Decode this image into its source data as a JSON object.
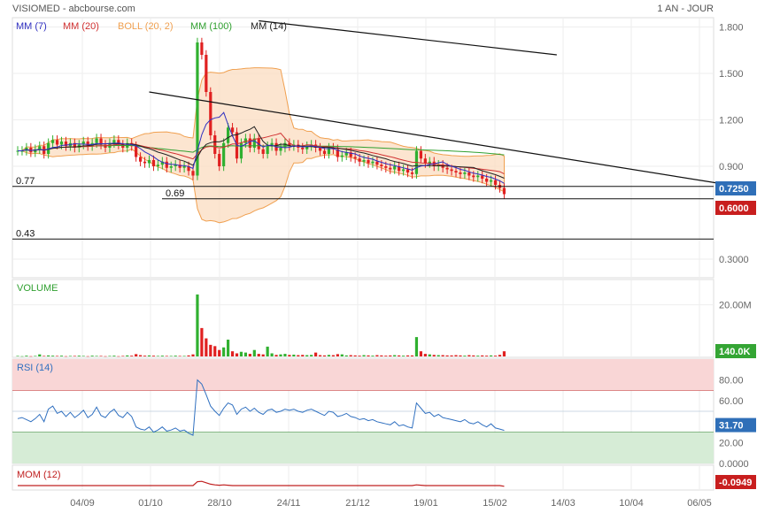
{
  "header": {
    "title": "VISIOMED - abcbourse.com",
    "period": "1 AN - JOUR"
  },
  "colors": {
    "mm7": "#3030c0",
    "mm20": "#d03030",
    "boll": "#f0a050",
    "boll_fill": "#fbdcc0",
    "mm100": "#30a030",
    "mm14": "#222222",
    "up": "#30b030",
    "down": "#e02020",
    "rsi_line": "#3070c0",
    "rsi_high_zone": "#f9d6d6",
    "rsi_low_zone": "#d6ecd6",
    "mom": "#c02020",
    "tag_blue": "#2f6fb8",
    "tag_red": "#c81e1e",
    "tag_green": "#34a534"
  },
  "chart_data": [
    {
      "type": "candlestick",
      "panel": "price",
      "legend": [
        {
          "label": "MM (7)",
          "color": "#3030c0"
        },
        {
          "label": "MM (20)",
          "color": "#d03030"
        },
        {
          "label": "BOLL (20, 2)",
          "color": "#f0a050"
        },
        {
          "label": "MM (100)",
          "color": "#30a030"
        },
        {
          "label": "MM (14)",
          "color": "#222222"
        }
      ],
      "y_ticks": [
        "1.800",
        "1.500",
        "1.200",
        "0.900",
        "0.3000"
      ],
      "y_tick_values": [
        1.8,
        1.5,
        1.2,
        0.9,
        0.3
      ],
      "ylim": [
        0.18,
        1.86
      ],
      "x_ticks": [
        "04/09",
        "01/10",
        "28/10",
        "24/11",
        "21/12",
        "19/01",
        "15/02",
        "14/03",
        "10/04",
        "06/05"
      ],
      "horizontal_lines": [
        {
          "value": 0.77,
          "label": "0.77"
        },
        {
          "value": 0.69,
          "label": "0.69"
        },
        {
          "value": 0.43,
          "label": "0.43"
        }
      ],
      "value_tags": [
        {
          "label": "0.7250",
          "value": 0.725,
          "color": "tag_blue"
        },
        {
          "label": "0.6000",
          "value": 0.6,
          "color": "tag_red"
        }
      ],
      "trend_lines": [
        {
          "from": [
            55,
            1.84
          ],
          "to": [
            123,
            1.62
          ]
        },
        {
          "from": [
            30,
            1.38
          ],
          "to": [
            160,
            0.79
          ]
        }
      ],
      "close": [
        1.0,
        1.0,
        1.02,
        0.99,
        1.01,
        1.03,
        0.98,
        1.05,
        1.07,
        1.04,
        1.06,
        1.03,
        1.05,
        1.02,
        1.04,
        1.06,
        1.03,
        1.05,
        1.08,
        1.04,
        1.02,
        1.05,
        1.07,
        1.04,
        1.02,
        1.05,
        1.03,
        0.96,
        0.93,
        0.92,
        0.94,
        0.9,
        0.91,
        0.93,
        0.89,
        0.9,
        0.91,
        0.89,
        0.9,
        0.87,
        0.84,
        1.7,
        1.62,
        1.38,
        1.1,
        0.98,
        0.9,
        1.05,
        1.15,
        1.12,
        0.95,
        1.05,
        1.08,
        1.02,
        1.08,
        1.01,
        0.98,
        1.03,
        1.05,
        1.0,
        1.02,
        1.05,
        1.03,
        1.04,
        1.02,
        1.01,
        1.03,
        1.04,
        1.02,
        1.0,
        0.98,
        1.02,
        1.01,
        0.96,
        0.97,
        0.99,
        0.96,
        0.95,
        0.93,
        0.94,
        0.92,
        0.93,
        0.91,
        0.9,
        0.89,
        0.88,
        0.9,
        0.87,
        0.88,
        0.86,
        0.85,
        1.0,
        0.95,
        0.92,
        0.93,
        0.9,
        0.91,
        0.89,
        0.88,
        0.87,
        0.86,
        0.85,
        0.86,
        0.84,
        0.83,
        0.84,
        0.82,
        0.8,
        0.81,
        0.78,
        0.76,
        0.72
      ],
      "volume_unit": "M",
      "volume_ticks": [
        "20.00M"
      ],
      "volume_tag": "140.0K",
      "volume": [
        0.2,
        0.1,
        0.3,
        0.1,
        0.2,
        0.8,
        0.2,
        0.4,
        0.3,
        0.2,
        0.3,
        0.1,
        0.2,
        0.2,
        0.3,
        0.2,
        0.1,
        0.3,
        0.2,
        0.2,
        0.1,
        0.2,
        0.3,
        0.1,
        0.2,
        0.4,
        0.3,
        0.9,
        0.5,
        0.3,
        0.4,
        0.3,
        0.2,
        0.3,
        0.2,
        0.2,
        0.3,
        0.2,
        0.2,
        0.4,
        0.8,
        24.0,
        11.0,
        7.0,
        4.5,
        4.0,
        2.5,
        3.5,
        6.5,
        2.0,
        1.2,
        1.8,
        1.5,
        1.0,
        2.5,
        1.0,
        0.8,
        3.8,
        1.2,
        0.6,
        0.8,
        1.0,
        0.6,
        0.7,
        0.5,
        0.6,
        0.5,
        0.6,
        1.5,
        0.5,
        0.4,
        0.6,
        0.5,
        0.9,
        0.8,
        0.4,
        0.5,
        0.4,
        0.3,
        0.5,
        0.4,
        0.3,
        0.5,
        0.4,
        0.3,
        0.4,
        0.5,
        0.4,
        0.3,
        0.4,
        0.4,
        7.5,
        2.0,
        1.0,
        0.8,
        0.6,
        0.5,
        0.5,
        0.4,
        0.4,
        0.5,
        0.4,
        0.3,
        0.5,
        0.4,
        0.3,
        0.4,
        0.3,
        0.4,
        0.3,
        0.6,
        2.0
      ]
    },
    {
      "type": "line",
      "panel": "rsi",
      "series": [
        {
          "name": "RSI (14)",
          "color": "#3070c0"
        }
      ],
      "y_ticks": [
        "80.00",
        "60.00",
        "40.00",
        "20.00",
        "0.0000"
      ],
      "y_tick_values": [
        80,
        60,
        40,
        20,
        0
      ],
      "ylim": [
        0,
        100
      ],
      "zones": [
        {
          "from": 70,
          "to": 100,
          "color": "rsi_high_zone"
        },
        {
          "from": 0,
          "to": 30,
          "color": "rsi_low_zone"
        }
      ],
      "tag": {
        "label": "31.70",
        "value": 31.7,
        "color": "tag_blue"
      },
      "values": [
        43,
        44,
        42,
        40,
        43,
        47,
        40,
        52,
        55,
        48,
        50,
        45,
        49,
        44,
        47,
        51,
        44,
        47,
        54,
        46,
        44,
        49,
        52,
        46,
        44,
        49,
        45,
        35,
        33,
        32,
        35,
        30,
        32,
        35,
        31,
        32,
        34,
        31,
        32,
        29,
        27,
        80,
        76,
        66,
        55,
        50,
        46,
        53,
        58,
        56,
        47,
        52,
        54,
        50,
        53,
        49,
        47,
        51,
        52,
        49,
        50,
        52,
        51,
        52,
        50,
        49,
        51,
        52,
        50,
        48,
        46,
        50,
        49,
        45,
        46,
        48,
        45,
        44,
        42,
        43,
        41,
        42,
        40,
        39,
        38,
        37,
        40,
        36,
        37,
        35,
        34,
        58,
        53,
        48,
        49,
        45,
        47,
        44,
        43,
        42,
        41,
        40,
        42,
        39,
        38,
        40,
        37,
        35,
        38,
        34,
        33,
        31.7
      ]
    },
    {
      "type": "line",
      "panel": "momentum",
      "series": [
        {
          "name": "MOM (12)",
          "color": "#c02020"
        }
      ],
      "tag": {
        "label": "-0.0949",
        "value": -0.0949,
        "color": "tag_red"
      },
      "values": [
        0,
        0,
        0,
        0,
        0,
        0,
        0,
        0,
        0,
        0,
        0,
        0,
        0,
        0,
        0,
        0,
        0,
        0,
        0,
        0,
        0,
        0,
        0,
        0,
        0,
        0,
        0,
        0,
        0,
        0,
        0,
        0,
        0,
        0,
        0,
        0,
        0,
        0,
        0,
        0,
        0,
        0.55,
        0.6,
        0.4,
        0.2,
        0.1,
        0.05,
        0.1,
        0.05,
        0,
        0,
        0,
        0,
        0,
        0,
        0,
        0,
        0,
        0,
        0,
        0,
        0,
        0,
        0,
        0,
        0,
        0,
        0,
        0,
        0,
        0,
        0,
        0,
        0,
        0,
        0,
        0,
        0,
        0,
        0,
        0,
        0,
        0,
        0,
        0,
        0,
        0,
        0,
        0,
        0,
        0,
        0.1,
        0.05,
        0,
        0,
        0,
        0,
        0,
        0,
        0,
        0,
        0,
        0,
        0,
        0,
        0,
        0,
        0,
        0,
        0,
        0,
        -0.0949
      ]
    }
  ]
}
